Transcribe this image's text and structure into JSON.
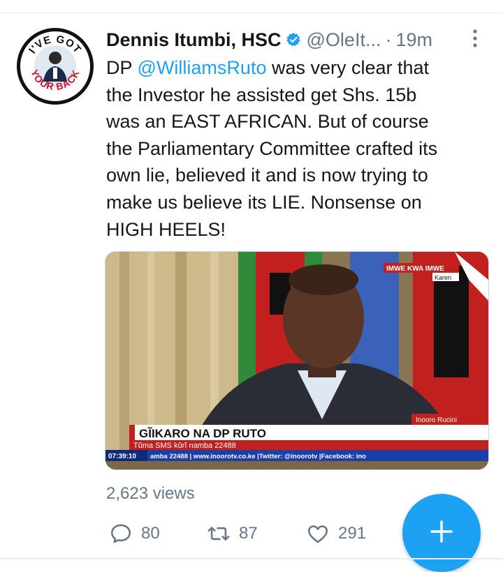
{
  "tweet": {
    "author_name": "Dennis Itumbi, HSC",
    "handle": "@OleIt...",
    "separator": "·",
    "time": "19m",
    "text_lines": [
      [
        "DP ",
        "@WilliamsRuto",
        " was very clear that"
      ],
      "the Investor he assisted get Shs. 15b",
      "was an EAST AFRICAN.  But of course",
      "the Parliamentary Committee crafted its",
      "own lie, believed it and is now trying to",
      "make us believe its LIE. Nonsense on",
      "HIGH HEELS!"
    ],
    "avatar_text_top": "I'VE GOT",
    "avatar_text_bottom": "YOUR BACK"
  },
  "media": {
    "corner_banner": "IMWE KWA IMWE",
    "corner_location": "Karen",
    "channel_tag": "Inooro Rucini",
    "headline": "GĨIKARO NA DP RUTO",
    "subline": "Tũma SMS kũrĩ namba 22488",
    "ticker_time": "07:39:10",
    "ticker_text": "amba 22488 | www.inoorotv.co.ke |Twitter: @inoorotv |Facebook: ino"
  },
  "stats": {
    "views": "2,623 views",
    "replies": "80",
    "retweets": "87",
    "likes": "291"
  },
  "icons": {
    "verified": "verified-badge-icon",
    "more": "more-vertical-icon",
    "reply": "reply-icon",
    "retweet": "retweet-icon",
    "like": "heart-icon",
    "compose": "plus-icon"
  },
  "colors": {
    "accent": "#1da1f2",
    "muted": "#657786",
    "text": "#14171a"
  }
}
